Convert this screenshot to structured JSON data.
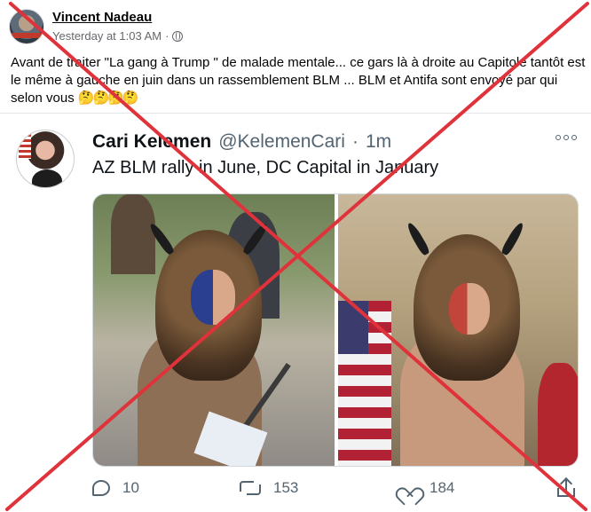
{
  "post": {
    "author": "Vincent Nadeau",
    "timestamp": "Yesterday at 1:03 AM",
    "separator": "·",
    "audience_icon": "globe-icon",
    "text": "Avant de traiter \"La gang à Trump \" de malade mentale... ce gars là à droite au Capitole tantôt est le même à gauche en juin dans un rassemblement BLM ... BLM et Antifa sont envoyé par qui selon vous",
    "emojis": "🤔🤔🤔🤔"
  },
  "tweet": {
    "display_name": "Cari Kelemen",
    "handle": "@KelemenCari",
    "dot": "·",
    "time": "1m",
    "text": "AZ BLM rally in June, DC Capital in January",
    "replies": "10",
    "retweets": "153",
    "likes": "184"
  },
  "overlay": {
    "type": "red-x",
    "color": "#e0323a"
  }
}
